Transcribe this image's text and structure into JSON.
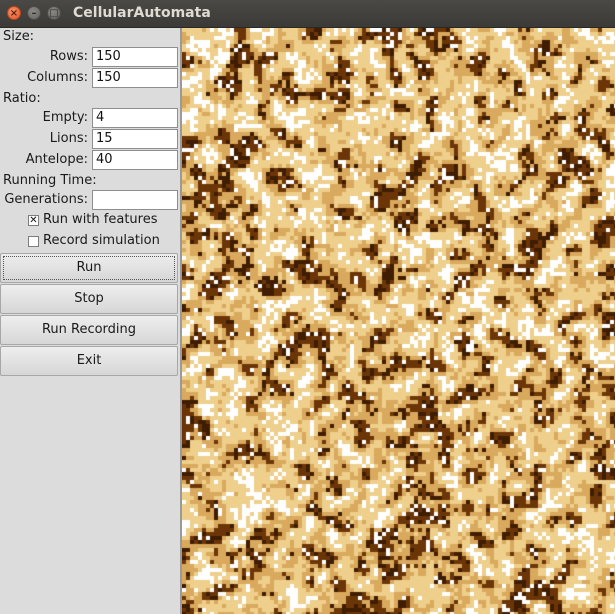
{
  "window": {
    "title": "CellularAutomata",
    "buttons": [
      "close-icon",
      "minimize-icon",
      "maximize-icon"
    ]
  },
  "controls": {
    "size_label": "Size:",
    "rows_label": "Rows:",
    "rows_value": "150",
    "columns_label": "Columns:",
    "columns_value": "150",
    "ratio_label": "Ratio:",
    "empty_label": "Empty:",
    "empty_value": "4",
    "lions_label": "Lions:",
    "lions_value": "15",
    "antelope_label": "Antelope:",
    "antelope_value": "40",
    "running_time_label": "Running Time:",
    "generations_label": "Generations:",
    "generations_value": "",
    "run_with_features_label": "Run with features",
    "run_with_features_checked": true,
    "record_simulation_label": "Record simulation",
    "record_simulation_checked": false
  },
  "buttons": {
    "run": "Run",
    "stop": "Stop",
    "run_recording": "Run Recording",
    "exit": "Exit"
  },
  "grid": {
    "colors": {
      "empty": "#ffffff",
      "light": "#eecf8c",
      "tan": "#d9a95e",
      "dark": "#6b3508",
      "darkest": "#3f1d02"
    }
  }
}
